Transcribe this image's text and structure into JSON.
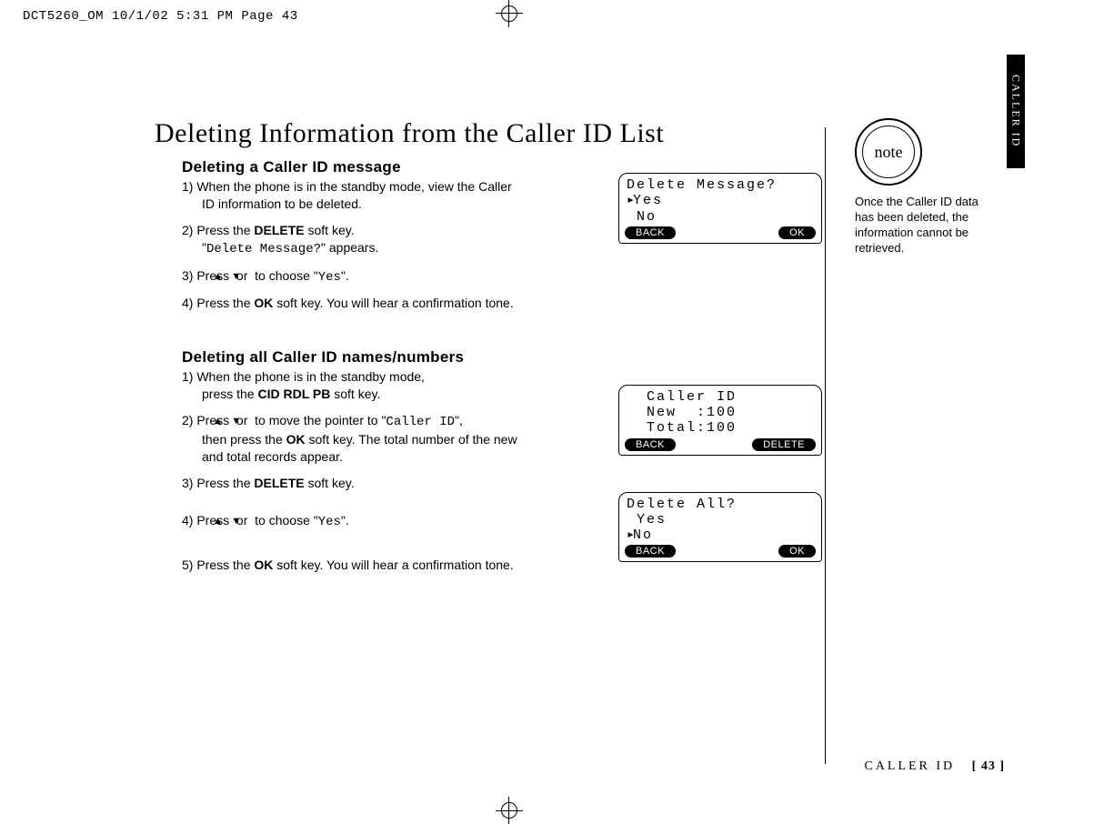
{
  "slug": "DCT5260_OM  10/1/02  5:31 PM  Page 43",
  "title": "Deleting Information from the Caller ID List",
  "section_a": {
    "heading": "Deleting a Caller ID message",
    "step1a": "1) When the phone is in the standby mode, view the Caller",
    "step1b": "ID information to be deleted.",
    "step2a": "2) Press the ",
    "step2b": "DELETE",
    "step2c": " soft key.",
    "step2d": "\"",
    "step2e": "Delete Message?",
    "step2f": "\" appears.",
    "step3a": "3) Press ",
    "step3b": " or ",
    "step3c": " to choose \"",
    "step3d": "Yes",
    "step3e": "\".",
    "step4a": "4) Press the ",
    "step4b": "OK",
    "step4c": " soft key. You will hear a confirmation tone."
  },
  "section_b": {
    "heading": "Deleting all Caller ID names/numbers",
    "step1a": "1) When the phone is in the standby mode,",
    "step1b": "press the ",
    "step1c": "CID RDL PB",
    "step1d": " soft key.",
    "step2a": "2) Press ",
    "step2b": " or ",
    "step2c": " to move the pointer to \"",
    "step2d": "Caller ID",
    "step2e": "\",",
    "step2f": "then press the ",
    "step2g": "OK",
    "step2h": " soft key. The total number of the new",
    "step2i": "and total records appear.",
    "step3a": "3) Press the ",
    "step3b": "DELETE",
    "step3c": " soft key.",
    "step4a": "4) Press ",
    "step4b": " or ",
    "step4c": " to choose \"",
    "step4d": "Yes",
    "step4e": "\".",
    "step5a": "5) Press the ",
    "step5b": "OK",
    "step5c": " soft key. You will hear a confirmation tone."
  },
  "lcd1": {
    "line1": "Delete Message?",
    "line2": "Yes",
    "line3": " No",
    "left": "BACK",
    "right": "OK"
  },
  "lcd2": {
    "line1": "  Caller ID",
    "line2": "  New  :100",
    "line3": "  Total:100",
    "left": "BACK",
    "right": "DELETE"
  },
  "lcd3": {
    "line1": "Delete All?",
    "line2": " Yes",
    "line3": "No",
    "left": "BACK",
    "right": "OK"
  },
  "note": {
    "label": "note",
    "text": "Once the Caller ID data has been deleted, the information cannot be retrieved."
  },
  "tab": "CALLER ID",
  "footer": {
    "section": "CALLER ID",
    "page": "[ 43 ]"
  },
  "glyph": {
    "up": "▲",
    "down": "▼",
    "ptr": "▸"
  }
}
